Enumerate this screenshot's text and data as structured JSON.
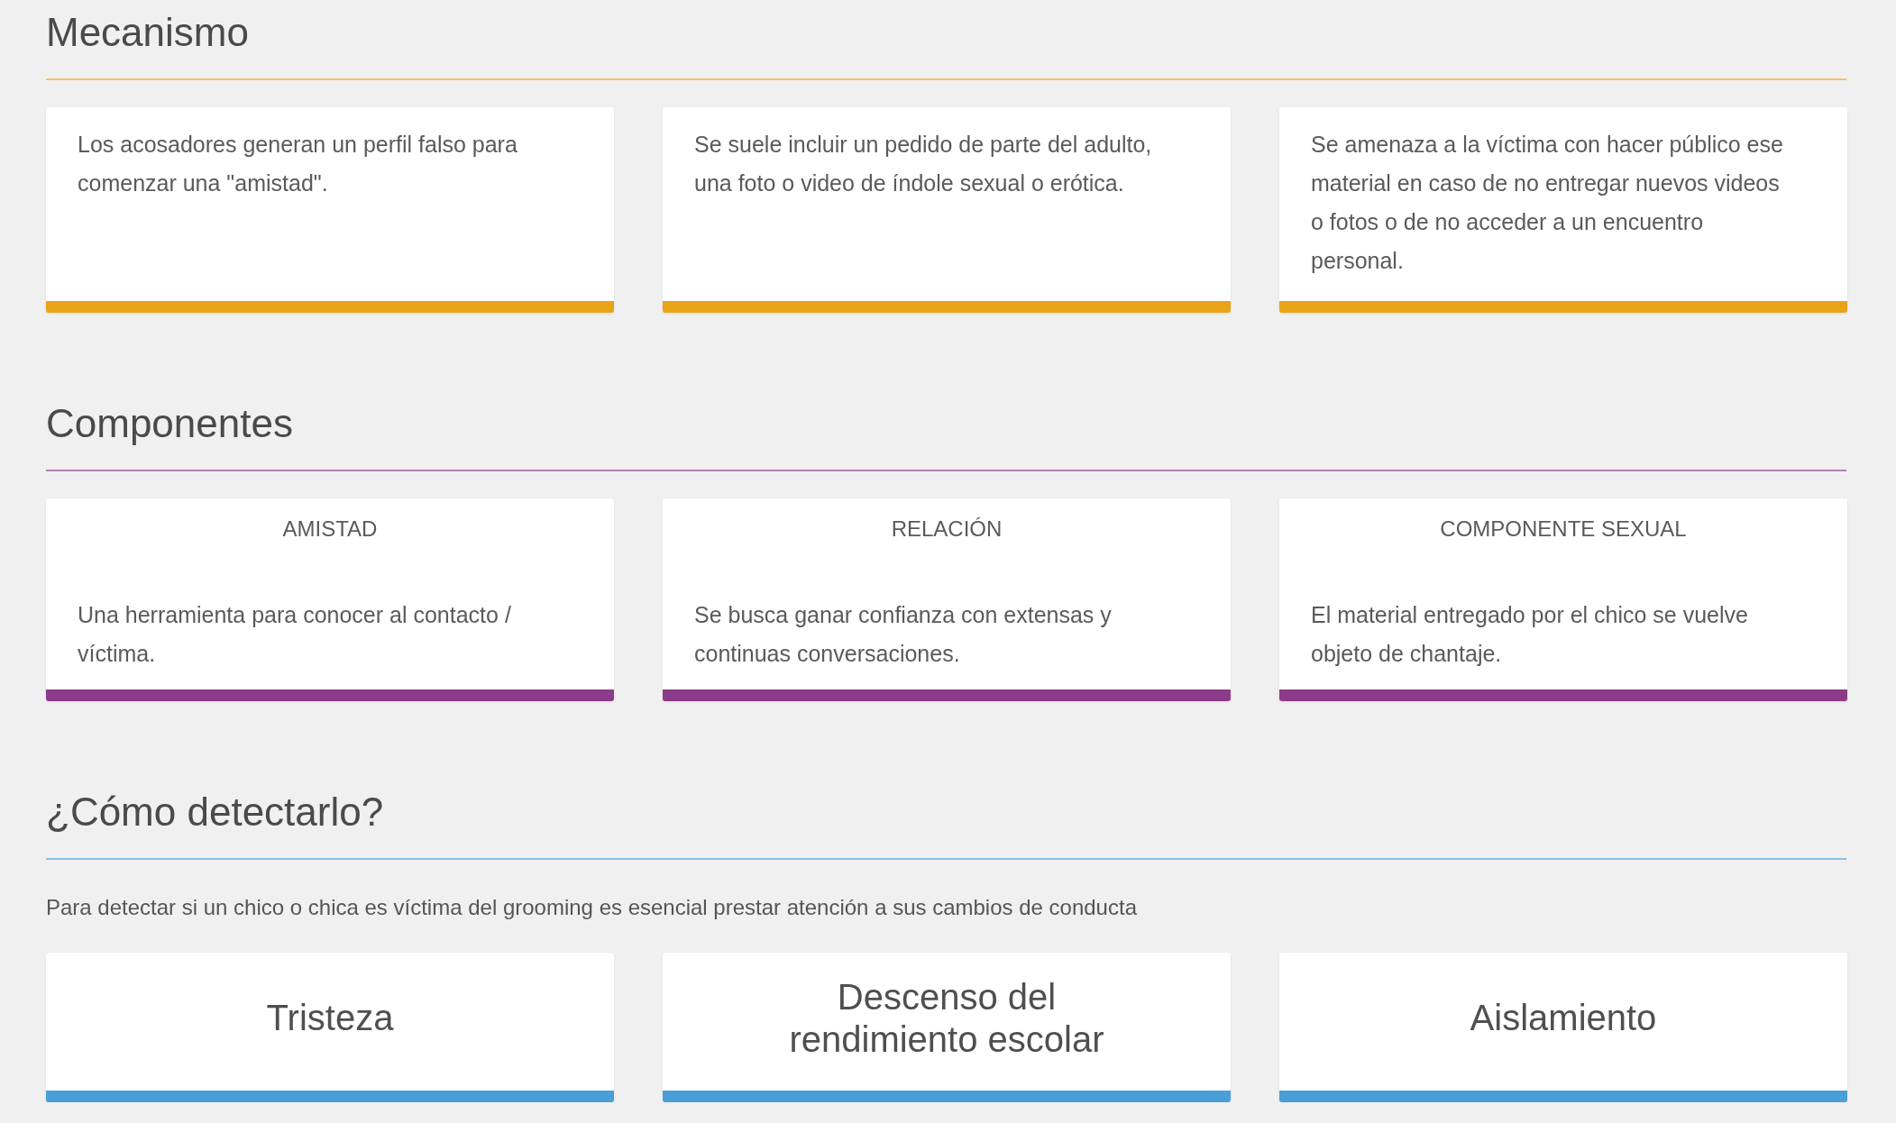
{
  "sections": [
    {
      "title": "Mecanismo",
      "color": "#e8a317",
      "cards": [
        {
          "kind": "text",
          "text": "Los acosadores generan un perfil falso para comenzar una \"amistad\"."
        },
        {
          "kind": "text",
          "text": "Se suele incluir un pedido de parte del adulto, una foto o video de índole sexual o erótica."
        },
        {
          "kind": "text",
          "text": "Se amenaza a la víctima con hacer público ese material en caso de no entregar nuevos videos o fotos o de no acceder a un encuentro personal."
        }
      ]
    },
    {
      "title": "Componentes",
      "color": "#8c3b88",
      "cards": [
        {
          "kind": "titled",
          "title": "AMISTAD",
          "text": "Una herramienta para conocer al contacto / víctima."
        },
        {
          "kind": "titled",
          "title": "RELACIÓN",
          "text": "Se busca ganar confianza con extensas y continuas conversaciones."
        },
        {
          "kind": "titled",
          "title": "COMPONENTE SEXUAL",
          "text": "El material entregado por el chico se vuelve objeto de chantaje."
        }
      ]
    },
    {
      "title": "¿Cómo detectarlo?",
      "color": "#4a9fd6",
      "intro": "Para detectar si un chico o chica es víctima del grooming es esencial prestar atención a sus cambios de conducta",
      "cards": [
        {
          "kind": "big",
          "text": "Tristeza"
        },
        {
          "kind": "big",
          "text": "Descenso del rendimiento escolar"
        },
        {
          "kind": "big",
          "text": "Aislamiento"
        }
      ]
    }
  ]
}
